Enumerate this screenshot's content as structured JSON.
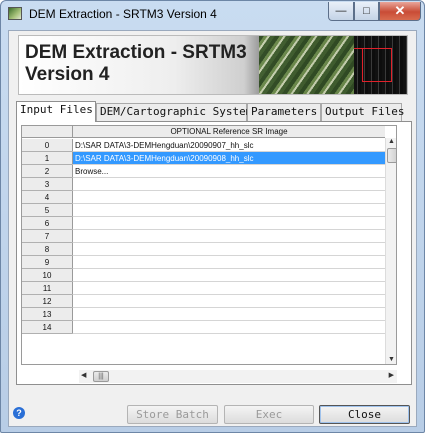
{
  "window": {
    "title": "DEM Extraction - SRTM3 Version 4"
  },
  "header": {
    "title": "DEM Extraction - SRTM3 Version 4"
  },
  "tabs": [
    {
      "label": "Input Files",
      "active": true
    },
    {
      "label": "DEM/Cartographic System",
      "active": false
    },
    {
      "label": "Parameters",
      "active": false
    },
    {
      "label": "Output Files",
      "active": false
    }
  ],
  "grid": {
    "column_header": "OPTIONAL Reference SR Image",
    "rows": [
      {
        "index": "0",
        "value": "D:\\SAR DATA\\3-DEMHengduan\\20090907_hh_slc",
        "selected": false
      },
      {
        "index": "1",
        "value": "D:\\SAR DATA\\3-DEMHengduan\\20090908_hh_slc",
        "selected": true
      },
      {
        "index": "2",
        "value": "Browse...",
        "selected": false
      },
      {
        "index": "3",
        "value": "",
        "selected": false
      },
      {
        "index": "4",
        "value": "",
        "selected": false
      },
      {
        "index": "5",
        "value": "",
        "selected": false
      },
      {
        "index": "6",
        "value": "",
        "selected": false
      },
      {
        "index": "7",
        "value": "",
        "selected": false
      },
      {
        "index": "8",
        "value": "",
        "selected": false
      },
      {
        "index": "9",
        "value": "",
        "selected": false
      },
      {
        "index": "10",
        "value": "",
        "selected": false
      },
      {
        "index": "11",
        "value": "",
        "selected": false
      },
      {
        "index": "12",
        "value": "",
        "selected": false
      },
      {
        "index": "13",
        "value": "",
        "selected": false
      },
      {
        "index": "14",
        "value": "",
        "selected": false
      }
    ]
  },
  "buttons": {
    "store_batch": "Store Batch",
    "exec": "Exec",
    "close": "Close"
  },
  "colors": {
    "selection": "#3399ff",
    "accent_red": "#e0212a"
  }
}
